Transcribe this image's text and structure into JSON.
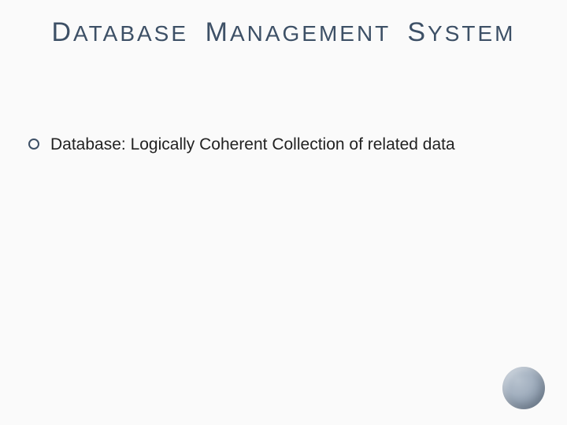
{
  "slide": {
    "title_words": [
      {
        "first": "D",
        "rest": "ATABASE"
      },
      {
        "first": "M",
        "rest": "ANAGEMENT"
      },
      {
        "first": "S",
        "rest": "YSTEM"
      }
    ],
    "bullets": [
      {
        "text": "Database: Logically Coherent Collection of related data"
      }
    ]
  }
}
